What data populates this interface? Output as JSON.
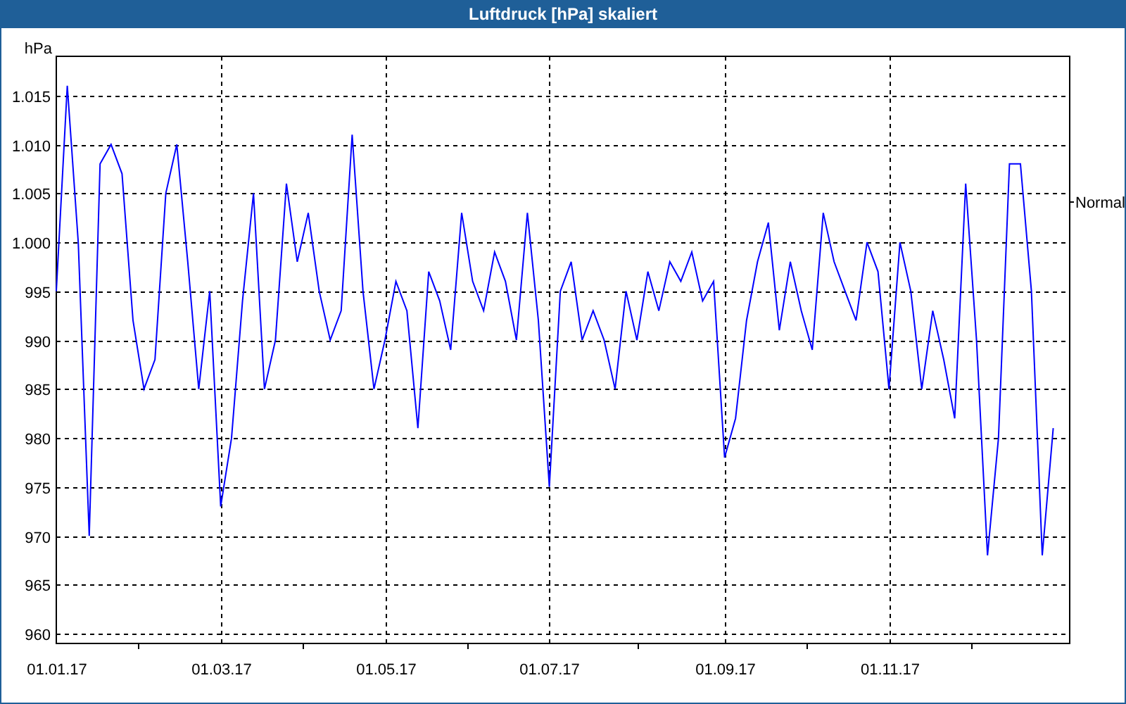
{
  "window": {
    "title": "Luftdruck [hPa] skaliert"
  },
  "chart": {
    "chart_data": {
      "type": "line",
      "grid": true,
      "ylabel": "hPa",
      "ylim": [
        959,
        1019
      ],
      "categories": [
        "01.01.17",
        null,
        null,
        null,
        null,
        null,
        null,
        null,
        null,
        null,
        null,
        null,
        null,
        null,
        null,
        "01.03.17",
        null,
        null,
        null,
        null,
        null,
        null,
        null,
        null,
        null,
        null,
        null,
        null,
        null,
        null,
        "01.05.17",
        null,
        null,
        null,
        null,
        null,
        null,
        null,
        null,
        null,
        null,
        null,
        null,
        null,
        null,
        "01.07.17",
        null,
        null,
        null,
        null,
        null,
        null,
        null,
        null,
        null,
        null,
        null,
        null,
        null,
        null,
        null,
        "01.09.17",
        null,
        null,
        null,
        null,
        null,
        null,
        null,
        null,
        null,
        null,
        null,
        null,
        null,
        null,
        "01.11.17",
        null,
        null,
        null,
        null,
        null,
        null,
        null,
        null,
        null,
        null,
        null,
        null,
        null,
        null,
        null
      ],
      "yticks": [
        {
          "value": 960,
          "label": "960"
        },
        {
          "value": 965,
          "label": "965"
        },
        {
          "value": 970,
          "label": "970"
        },
        {
          "value": 975,
          "label": "975"
        },
        {
          "value": 980,
          "label": "980"
        },
        {
          "value": 985,
          "label": "985"
        },
        {
          "value": 990,
          "label": "990"
        },
        {
          "value": 995,
          "label": "995"
        },
        {
          "value": 1000,
          "label": "1.000"
        },
        {
          "value": 1005,
          "label": "1.005"
        },
        {
          "value": 1010,
          "label": "1.010"
        },
        {
          "value": 1015,
          "label": "1.015"
        }
      ],
      "series": [
        {
          "color": "#0000ff",
          "values": [
            995,
            1016,
            1000,
            970,
            1008,
            1010,
            1007,
            992,
            985,
            988,
            1005,
            1010,
            998,
            985,
            995,
            973,
            980,
            994,
            1005,
            985,
            990,
            1006,
            998,
            1003,
            995,
            990,
            993,
            1011,
            995,
            985,
            990,
            996,
            993,
            981,
            997,
            994,
            989,
            1003,
            996,
            993,
            999,
            996,
            990,
            1003,
            992,
            975,
            995,
            998,
            990,
            993,
            990,
            985,
            995,
            990,
            997,
            993,
            998,
            996,
            999,
            994,
            996,
            978,
            982,
            992,
            998,
            1002,
            991,
            998,
            993,
            989,
            1003,
            998,
            995,
            992,
            1000,
            997,
            985,
            1000,
            995,
            985,
            993,
            988,
            982,
            1006,
            990,
            968,
            980,
            1008,
            1008,
            995,
            968,
            981
          ]
        }
      ],
      "annotations": [
        "Normal"
      ]
    }
  }
}
